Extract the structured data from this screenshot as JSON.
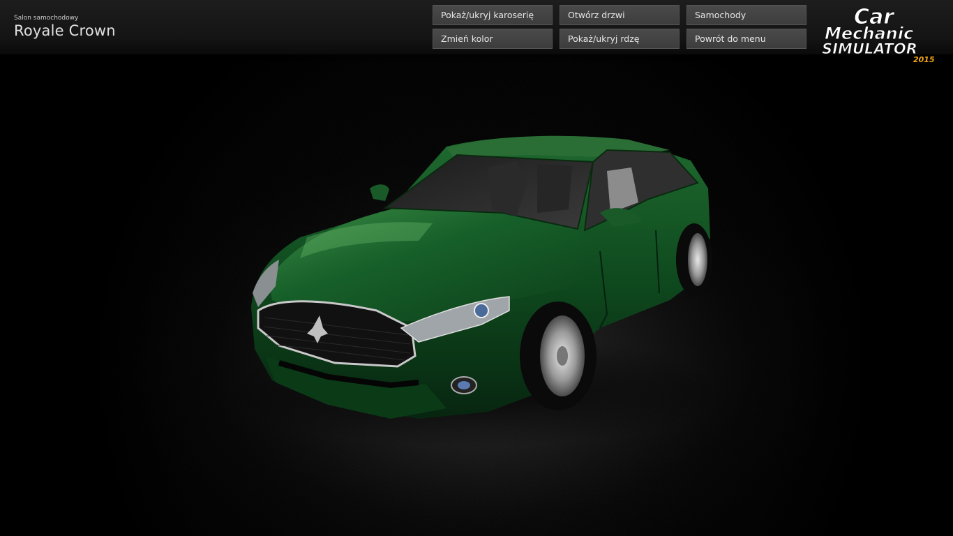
{
  "header": {
    "subtitle": "Salon samochodowy",
    "car_name": "Royale Crown"
  },
  "menu": {
    "buttons": [
      {
        "label": "Pokaż/ukryj karoserię"
      },
      {
        "label": "Otwórz drzwi"
      },
      {
        "label": "Samochody"
      },
      {
        "label": "Zmień kolor"
      },
      {
        "label": "Pokaż/ukryj rdzę"
      },
      {
        "label": "Powrót do menu"
      }
    ]
  },
  "logo": {
    "line1": "Car",
    "line2": "Mechanic",
    "line3": "SIMULATOR",
    "year": "2015"
  },
  "colors": {
    "car_body": "#0f4a1e",
    "car_highlight": "#3f8a4a",
    "button_bg": "#434343",
    "logo_year": "#f2a51a"
  }
}
